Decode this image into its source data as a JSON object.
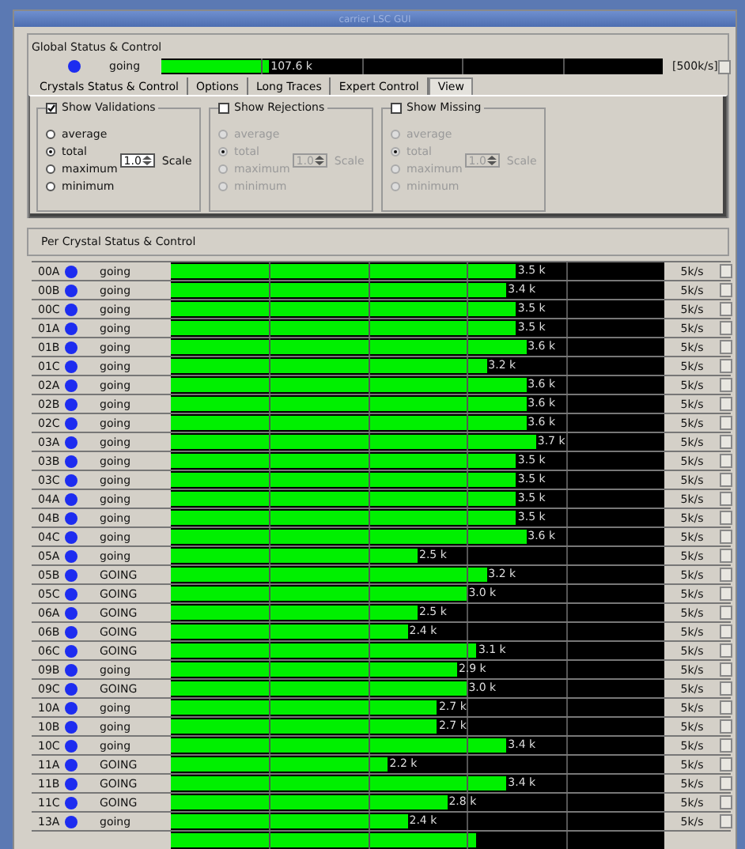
{
  "window": {
    "title": "carrier LSC GUI"
  },
  "global": {
    "title": "Global Status & Control",
    "status": "going",
    "level": 0.215,
    "reading": "107.6 k",
    "scale": "[500k/s]"
  },
  "tabs": [
    {
      "label": "Crystals Status & Control",
      "selected": false
    },
    {
      "label": "Options",
      "selected": false
    },
    {
      "label": "Long Traces",
      "selected": false
    },
    {
      "label": "Expert Control",
      "selected": false
    },
    {
      "label": "View",
      "selected": true
    }
  ],
  "groups": [
    {
      "title": "Show Validations",
      "checked": true,
      "options": [
        {
          "label": "average",
          "selected": false
        },
        {
          "label": "total",
          "selected": true
        },
        {
          "label": "maximum",
          "selected": false
        },
        {
          "label": "minimum",
          "selected": false
        }
      ],
      "spin": "1.0",
      "scale_label": "Scale"
    },
    {
      "title": "Show Rejections",
      "checked": false,
      "options": [
        {
          "label": "average",
          "selected": false
        },
        {
          "label": "total",
          "selected": true
        },
        {
          "label": "maximum",
          "selected": false
        },
        {
          "label": "minimum",
          "selected": false
        }
      ],
      "spin": "1.0",
      "scale_label": "Scale"
    },
    {
      "title": "Show Missing",
      "checked": false,
      "options": [
        {
          "label": "average",
          "selected": false
        },
        {
          "label": "total",
          "selected": true
        },
        {
          "label": "maximum",
          "selected": false
        },
        {
          "label": "minimum",
          "selected": false
        }
      ],
      "spin": "1.0",
      "scale_label": "Scale"
    }
  ],
  "crystals": {
    "title": "Per Crystal Status & Control",
    "rows": [
      {
        "id": "00A",
        "status": "going",
        "level": 0.7,
        "reading": "3.5 k",
        "rate": "5k/s"
      },
      {
        "id": "00B",
        "status": "going",
        "level": 0.68,
        "reading": "3.4 k",
        "rate": "5k/s"
      },
      {
        "id": "00C",
        "status": "going",
        "level": 0.7,
        "reading": "3.5 k",
        "rate": "5k/s"
      },
      {
        "id": "01A",
        "status": "going",
        "level": 0.7,
        "reading": "3.5 k",
        "rate": "5k/s"
      },
      {
        "id": "01B",
        "status": "going",
        "level": 0.72,
        "reading": "3.6 k",
        "rate": "5k/s"
      },
      {
        "id": "01C",
        "status": "going",
        "level": 0.64,
        "reading": "3.2 k",
        "rate": "5k/s"
      },
      {
        "id": "02A",
        "status": "going",
        "level": 0.72,
        "reading": "3.6 k",
        "rate": "5k/s"
      },
      {
        "id": "02B",
        "status": "going",
        "level": 0.72,
        "reading": "3.6 k",
        "rate": "5k/s"
      },
      {
        "id": "02C",
        "status": "going",
        "level": 0.72,
        "reading": "3.6 k",
        "rate": "5k/s"
      },
      {
        "id": "03A",
        "status": "going",
        "level": 0.74,
        "reading": "3.7 k",
        "rate": "5k/s"
      },
      {
        "id": "03B",
        "status": "going",
        "level": 0.7,
        "reading": "3.5 k",
        "rate": "5k/s"
      },
      {
        "id": "03C",
        "status": "going",
        "level": 0.7,
        "reading": "3.5 k",
        "rate": "5k/s"
      },
      {
        "id": "04A",
        "status": "going",
        "level": 0.7,
        "reading": "3.5 k",
        "rate": "5k/s"
      },
      {
        "id": "04B",
        "status": "going",
        "level": 0.7,
        "reading": "3.5 k",
        "rate": "5k/s"
      },
      {
        "id": "04C",
        "status": "going",
        "level": 0.72,
        "reading": "3.6 k",
        "rate": "5k/s"
      },
      {
        "id": "05A",
        "status": "going",
        "level": 0.5,
        "reading": "2.5 k",
        "rate": "5k/s"
      },
      {
        "id": "05B",
        "status": "GOING",
        "level": 0.64,
        "reading": "3.2 k",
        "rate": "5k/s"
      },
      {
        "id": "05C",
        "status": "GOING",
        "level": 0.6,
        "reading": "3.0 k",
        "rate": "5k/s"
      },
      {
        "id": "06A",
        "status": "GOING",
        "level": 0.5,
        "reading": "2.5 k",
        "rate": "5k/s"
      },
      {
        "id": "06B",
        "status": "GOING",
        "level": 0.48,
        "reading": "2.4 k",
        "rate": "5k/s"
      },
      {
        "id": "06C",
        "status": "GOING",
        "level": 0.62,
        "reading": "3.1 k",
        "rate": "5k/s"
      },
      {
        "id": "09B",
        "status": "going",
        "level": 0.58,
        "reading": "2.9 k",
        "rate": "5k/s"
      },
      {
        "id": "09C",
        "status": "GOING",
        "level": 0.6,
        "reading": "3.0 k",
        "rate": "5k/s"
      },
      {
        "id": "10A",
        "status": "going",
        "level": 0.54,
        "reading": "2.7 k",
        "rate": "5k/s"
      },
      {
        "id": "10B",
        "status": "going",
        "level": 0.54,
        "reading": "2.7 k",
        "rate": "5k/s"
      },
      {
        "id": "10C",
        "status": "going",
        "level": 0.68,
        "reading": "3.4 k",
        "rate": "5k/s"
      },
      {
        "id": "11A",
        "status": "GOING",
        "level": 0.44,
        "reading": "2.2 k",
        "rate": "5k/s"
      },
      {
        "id": "11B",
        "status": "GOING",
        "level": 0.68,
        "reading": "3.4 k",
        "rate": "5k/s"
      },
      {
        "id": "11C",
        "status": "GOING",
        "level": 0.56,
        "reading": "2.8 k",
        "rate": "5k/s"
      },
      {
        "id": "13A",
        "status": "going",
        "level": 0.48,
        "reading": "2.4 k",
        "rate": "5k/s"
      }
    ]
  }
}
